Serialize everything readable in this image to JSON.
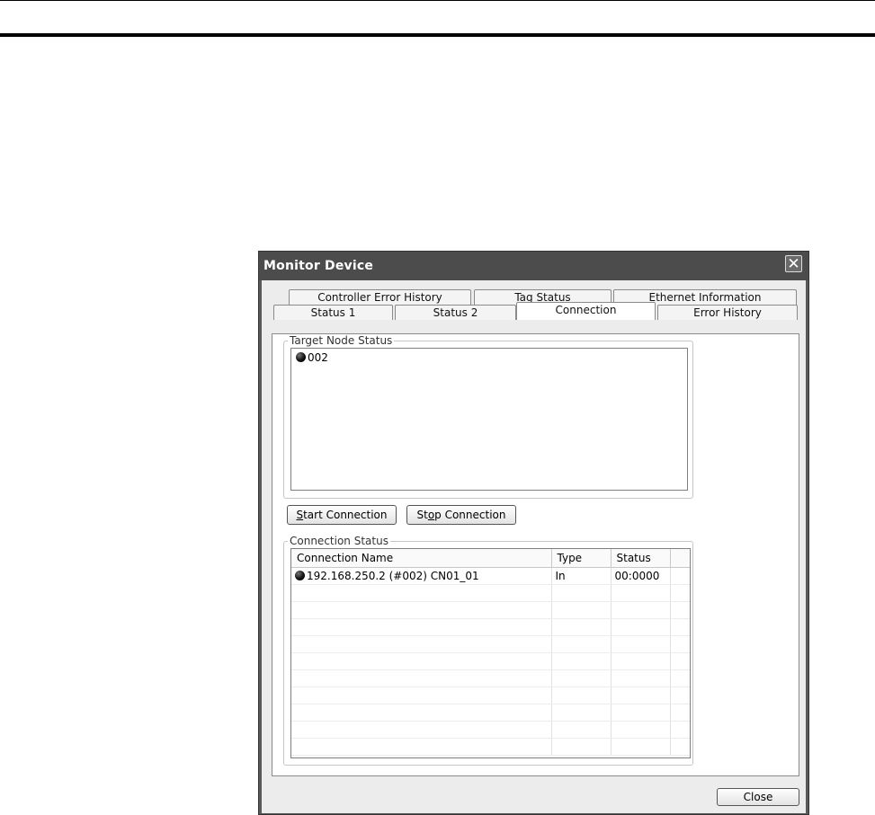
{
  "window": {
    "title": "Monitor Device",
    "close_glyph": "✕"
  },
  "tabs": {
    "row_back": [
      {
        "label": "Controller Error History"
      },
      {
        "label": "Tag Status"
      },
      {
        "label": "Ethernet Information"
      }
    ],
    "row_front": [
      {
        "label": "Status 1"
      },
      {
        "label": "Status 2"
      },
      {
        "label": "Connection",
        "active": true
      },
      {
        "label": "Error History"
      }
    ]
  },
  "target_node_status": {
    "legend": "Target Node Status",
    "nodes": [
      {
        "label": "002",
        "status_icon": "black-circle-icon"
      }
    ]
  },
  "buttons": {
    "start_connection": {
      "prefix": "",
      "mnemonic": "S",
      "rest": "tart Connection"
    },
    "stop_connection": {
      "prefix": "St",
      "mnemonic": "o",
      "rest": "p Connection"
    },
    "close": "Close"
  },
  "connection_status": {
    "legend": "Connection Status",
    "columns": [
      "Connection Name",
      "Type",
      "Status"
    ],
    "rows": [
      {
        "name": "192.168.250.2 (#002) CN01_01",
        "type": "In",
        "status": "00:0000",
        "status_icon": "black-circle-icon"
      }
    ],
    "empty_rows": 10
  }
}
